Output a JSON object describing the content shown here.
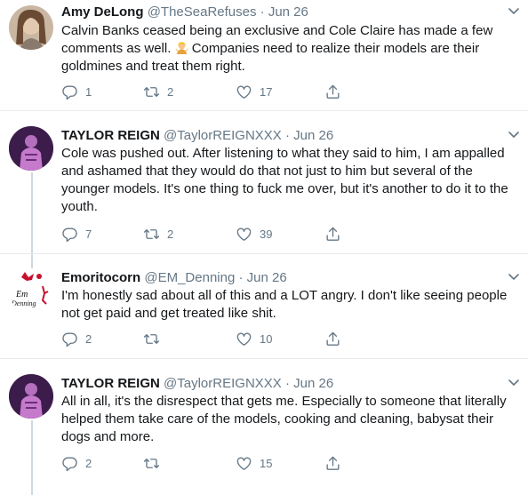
{
  "tweets": [
    {
      "name": "Amy DeLong",
      "handle": "@TheSeaRefuses",
      "date": "· Jun 26",
      "lines": [
        "Calvin Banks ceased being an exclusive and Cole Claire has made a few",
        "comments as well.",
        "Companies need to realize their models are their",
        "goldmines and treat them right."
      ],
      "emoji": "woman-shrugging-emoji",
      "replies": "1",
      "retweets": "2",
      "likes": "17"
    },
    {
      "name": "TAYLOR REIGN",
      "handle": "@TaylorREIGNXXX",
      "date": "· Jun 26",
      "lines": [
        "Cole was pushed out. After listening to what they said to him, I am appalled",
        "and ashamed that they would do that not just to him but several of the",
        "younger models. It's one thing to fuck me over, but it's another to do it to the",
        "youth."
      ],
      "replies": "7",
      "retweets": "2",
      "likes": "39"
    },
    {
      "name": "Emoritocorn",
      "handle": "@EM_Denning",
      "date": "· Jun 26",
      "avatar_text": "Em Denning",
      "lines": [
        "I'm honestly sad about all of this and a LOT angry. I don't like seeing people",
        "not get paid and get treated like shit."
      ],
      "replies": "2",
      "retweets": "",
      "likes": "10"
    },
    {
      "name": "TAYLOR REIGN",
      "handle": "@TaylorREIGNXXX",
      "date": "· Jun 26",
      "lines": [
        "All in all, it's the disrespect that gets me. Especially to someone that literally",
        "helped them take care of the models, cooking and cleaning, babysat their",
        "dogs and more."
      ],
      "replies": "2",
      "retweets": "",
      "likes": "15"
    }
  ],
  "colors": {
    "text": "#14171a",
    "secondary": "#657786",
    "thread_line": "#cfd9de",
    "separator": "#e6ecf0"
  },
  "icons": [
    "reply-icon",
    "retweet-icon",
    "like-icon",
    "share-icon",
    "caret-down-icon"
  ]
}
